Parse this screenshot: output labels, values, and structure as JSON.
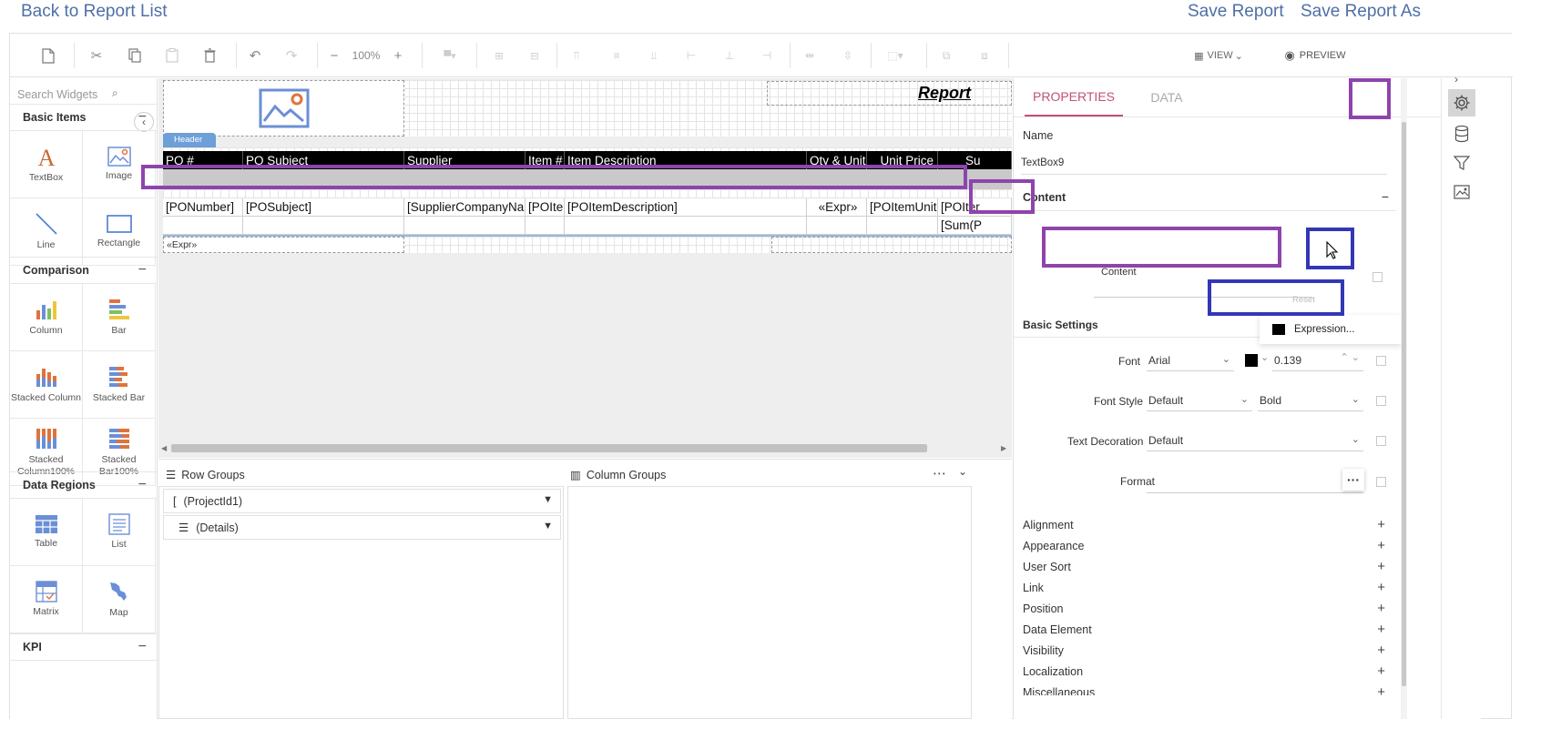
{
  "topbar": {
    "back_label": "Back to Report List",
    "save_label": "Save Report",
    "save_as_label": "Save Report As"
  },
  "toolbar": {
    "zoom": "100%",
    "view_label": "VIEW",
    "preview_label": "PREVIEW"
  },
  "widgets": {
    "search_placeholder": "Search Widgets",
    "categories": [
      {
        "label": "Basic Items",
        "items": [
          "TextBox",
          "Image",
          "Line",
          "Rectangle"
        ]
      },
      {
        "label": "Comparison",
        "items": [
          "Column",
          "Bar",
          "Stacked Column",
          "Stacked Bar",
          "Stacked Column100%",
          "Stacked Bar100%"
        ]
      },
      {
        "label": "Data Regions",
        "items": [
          "Table",
          "List",
          "Matrix",
          "Map"
        ]
      },
      {
        "label": "KPI",
        "items": []
      }
    ]
  },
  "canvas": {
    "report_title": "Report",
    "header_tag": "Header",
    "columns": [
      "PO #",
      "PO Subject",
      "Supplier",
      "Item #",
      "Item Description",
      "Qty & Unit",
      "Unit Price",
      "Su"
    ],
    "detail_row": [
      "[PONumber]",
      "[POSubject]",
      "[SupplierCompanyNam",
      "[POIter",
      "[POItemDescription]",
      "«Expr»",
      "[POItemUnitP",
      "[POIter"
    ],
    "sum_cell": "[Sum(P",
    "footer_expr": "«Expr»"
  },
  "groups": {
    "row_title": "Row Groups",
    "column_title": "Column Groups",
    "row_items": [
      "(ProjectId1)",
      "(Details)"
    ]
  },
  "properties": {
    "tab_properties": "PROPERTIES",
    "tab_data": "DATA",
    "name_label": "Name",
    "name_value": "TextBox9",
    "content_section": "Content",
    "content_field_label": "Content",
    "reset_label": "Reset",
    "expression_label": "Expression...",
    "basic_settings": "Basic Settings",
    "font_label": "Font",
    "font_value": "Arial",
    "font_size": "0.139",
    "font_style_label": "Font Style",
    "font_style_value": "Default",
    "font_weight_value": "Bold",
    "text_decoration_label": "Text Decoration",
    "text_decoration_value": "Default",
    "format_label": "Format",
    "sections": [
      "Alignment",
      "Appearance",
      "User Sort",
      "Link",
      "Position",
      "Data Element",
      "Visibility",
      "Localization",
      "Miscellaneous"
    ]
  },
  "colors": {
    "accent": "#c2507a",
    "link": "#4f6fa6",
    "highlight_purple": "#8e44ad",
    "highlight_blue": "#3437b5",
    "header_tag": "#6d9fd8"
  }
}
